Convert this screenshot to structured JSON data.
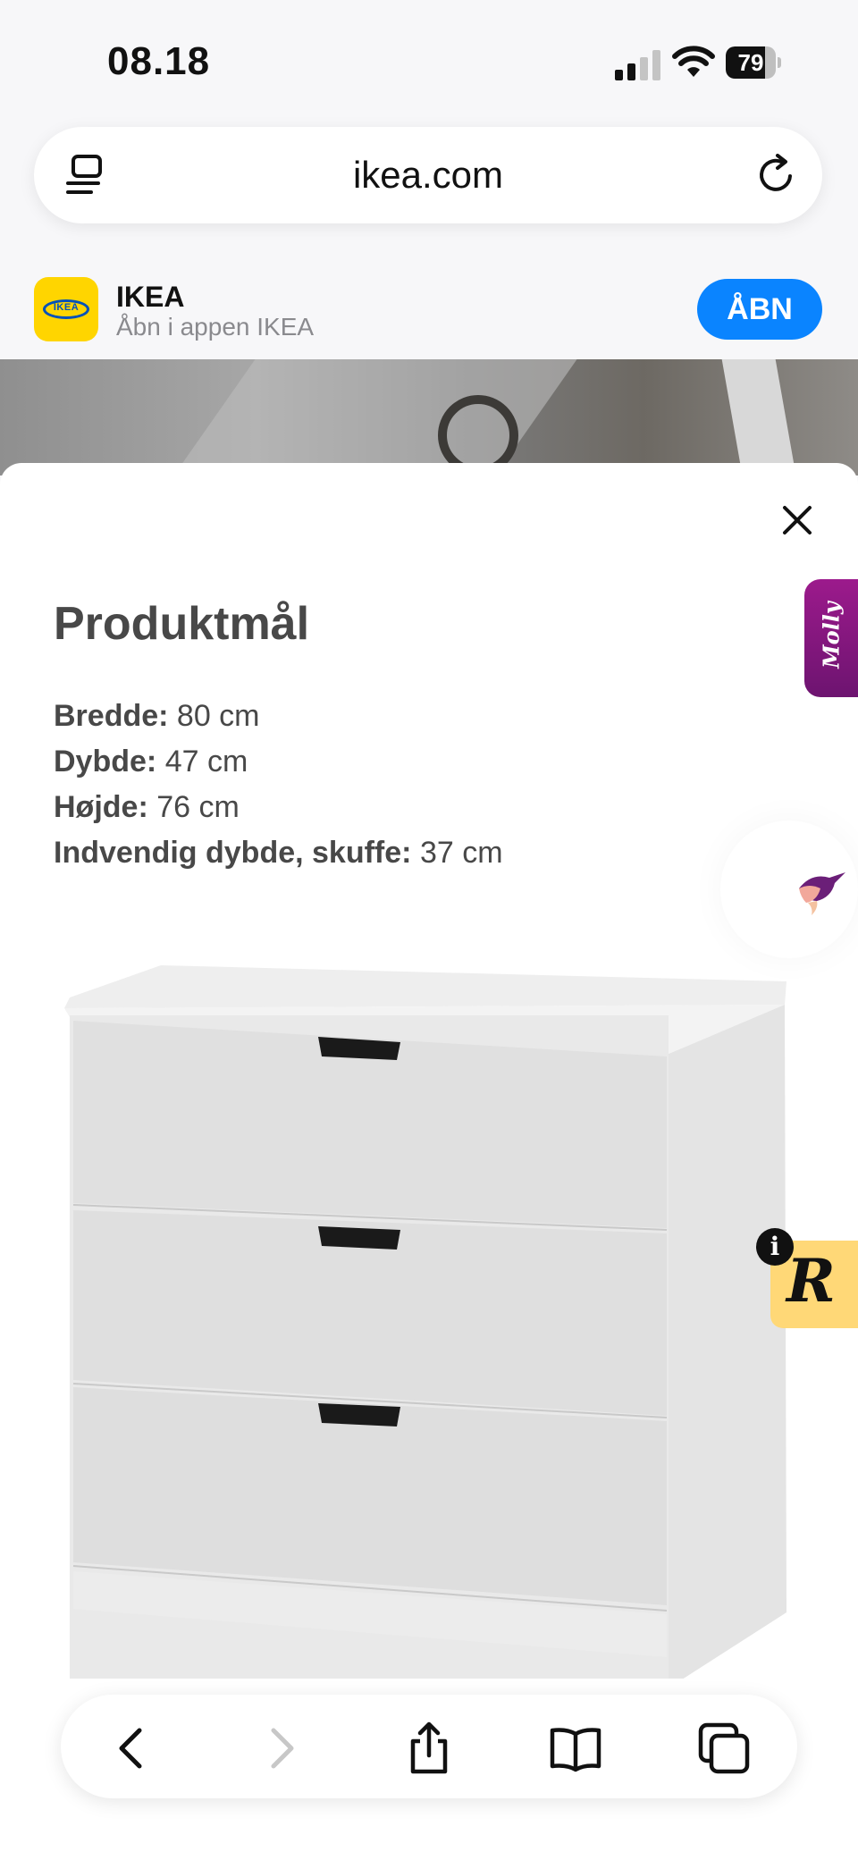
{
  "status_bar": {
    "time": "08.18",
    "battery_level": "79",
    "battery_fraction": 0.79
  },
  "browser": {
    "url": "ikea.com"
  },
  "app_banner": {
    "app_name": "IKEA",
    "subtitle": "Åbn i appen IKEA",
    "open_label": "ÅBN",
    "logo_text": "IKEA"
  },
  "modal": {
    "title": "Produktmål",
    "dimensions": [
      {
        "label": "Bredde:",
        "value": "80 cm"
      },
      {
        "label": "Dybde:",
        "value": "47 cm"
      },
      {
        "label": "Højde:",
        "value": "76 cm"
      },
      {
        "label": "Indvendig dybde, skuffe:",
        "value": "37 cm"
      }
    ]
  },
  "widgets": {
    "molly_label": "Molly",
    "r_label": "R",
    "info_label": "i"
  },
  "colors": {
    "accent_blue": "#0a84ff",
    "ikea_yellow": "#ffd500",
    "ikea_blue": "#0051ba",
    "molly_purple": "#9c1a8c",
    "r_widget_yellow": "#ffd877"
  },
  "icons": {
    "reader": "reader-icon",
    "reload": "reload-icon",
    "close": "close-icon",
    "back": "chevron-left-icon",
    "forward": "chevron-right-icon",
    "share": "share-icon",
    "bookmarks": "book-icon",
    "tabs": "tabs-icon"
  }
}
